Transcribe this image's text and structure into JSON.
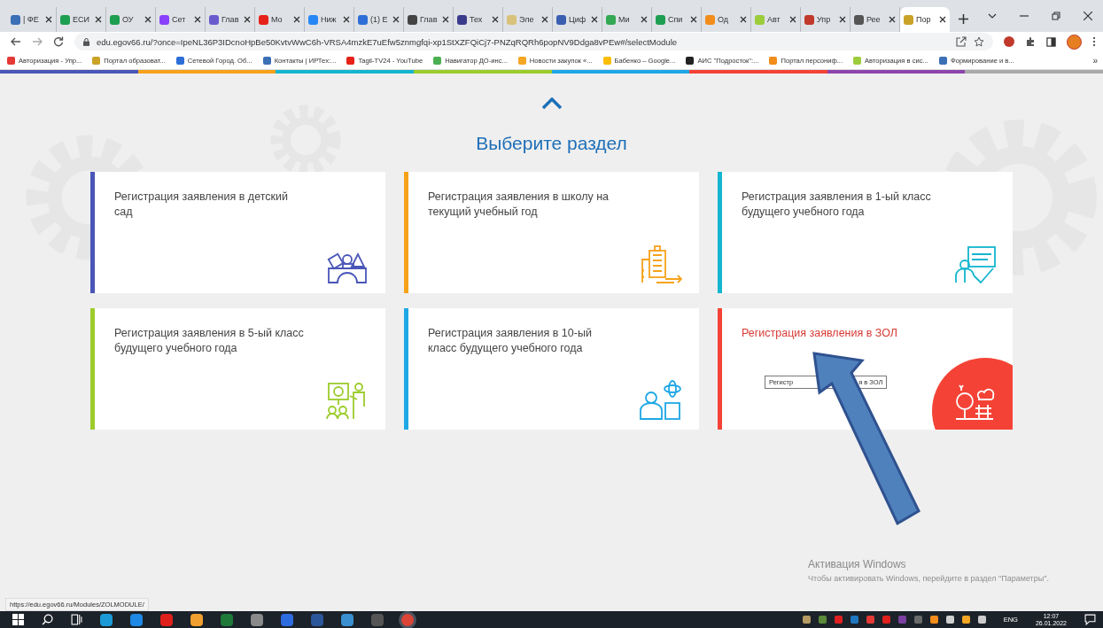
{
  "browser": {
    "tabs": [
      {
        "title": "| ФЕ",
        "selected": false,
        "color": "#3b6fb6"
      },
      {
        "title": "ЕСИ",
        "selected": false,
        "color": "#1e9e50"
      },
      {
        "title": "ОУ",
        "selected": false,
        "color": "#1e9e50"
      },
      {
        "title": "Сет",
        "selected": false,
        "color": "#8a3ffc"
      },
      {
        "title": "Глав",
        "selected": false,
        "color": "#6a5acd"
      },
      {
        "title": "Мо",
        "selected": false,
        "color": "#e62117"
      },
      {
        "title": "Ниж",
        "selected": false,
        "color": "#2787f5"
      },
      {
        "title": "(1) E",
        "selected": false,
        "color": "#2d6fd6"
      },
      {
        "title": "Глав",
        "selected": false,
        "color": "#444444"
      },
      {
        "title": "Тех",
        "selected": false,
        "color": "#3a3a8c"
      },
      {
        "title": "Эле",
        "selected": false,
        "color": "#d9c27a"
      },
      {
        "title": "Циф",
        "selected": false,
        "color": "#3a5fb0"
      },
      {
        "title": "Ми",
        "selected": false,
        "color": "#34a853"
      },
      {
        "title": "Спи",
        "selected": false,
        "color": "#1e9e50"
      },
      {
        "title": "Од",
        "selected": false,
        "color": "#f28c1b"
      },
      {
        "title": "Авт",
        "selected": false,
        "color": "#9ccc3c"
      },
      {
        "title": "Упр",
        "selected": false,
        "color": "#c0392b"
      },
      {
        "title": "Рее",
        "selected": false,
        "color": "#555555"
      },
      {
        "title": "Пор",
        "selected": true,
        "color": "#c9a227"
      }
    ],
    "url": "edu.egov66.ru/?once=IpeNL36P3IDcnoHpBe50KvtvWwC6h-VRSA4mzkE7uEfw5znmgfqi-xp1StXZFQiCj7-PNZqRQRh6popNV9Ddga8vPEw#/selectModule",
    "bookmarks": [
      {
        "title": "Авторизация - Упр...",
        "color": "#e53935"
      },
      {
        "title": "Портал образоват...",
        "color": "#c9a227"
      },
      {
        "title": "Сетевой Город. Об...",
        "color": "#2d6fd6"
      },
      {
        "title": "Контакты | ИРТех:...",
        "color": "#3b6fb6"
      },
      {
        "title": "Tagil-TV24 - YouTube",
        "color": "#e62117"
      },
      {
        "title": "Навигатор ДО-инс...",
        "color": "#4caf50"
      },
      {
        "title": "Новости закупок «...",
        "color": "#f5a623"
      },
      {
        "title": "Бабенко – Google...",
        "color": "#fbbc04"
      },
      {
        "title": "АИС \"Подросток\":...",
        "color": "#222222"
      },
      {
        "title": "Портал персониф...",
        "color": "#f28c1b"
      },
      {
        "title": "Авторизация в сис...",
        "color": "#9ccc3c"
      },
      {
        "title": "Формирование и в...",
        "color": "#3b6fb6"
      }
    ],
    "bookmarks_more": "»",
    "status_url": "https://edu.egov66.ru/Modules/ZOLMODULE/"
  },
  "page": {
    "heading": "Выберите раздел",
    "tiles": [
      {
        "title": "Регистрация заявления в детский сад",
        "color": "#4a56b8",
        "hovered": false
      },
      {
        "title": "Регистрация заявления в школу на текущий учебный год",
        "color": "#f7a21b",
        "hovered": false
      },
      {
        "title": "Регистрация заявления в 1-ый класс будущего учебного года",
        "color": "#13b5cf",
        "hovered": false
      },
      {
        "title": "Регистрация заявления в 5-ый класс будущего учебного года",
        "color": "#9ccc2c",
        "hovered": false
      },
      {
        "title": "Регистрация заявления в 10-ый класс будущего учебного года",
        "color": "#1ea7e6",
        "hovered": false
      },
      {
        "title": "Регистрация заявления в ЗОЛ",
        "color": "#f44336",
        "hovered": true
      }
    ],
    "tooltip": {
      "visible_start": "Регистр",
      "visible_end": "я в ЗОЛ"
    }
  },
  "windows_activation": {
    "title": "Активация Windows",
    "text": "Чтобы активировать Windows, перейдите в раздел \"Параметры\"."
  },
  "taskbar": {
    "language": "ENG",
    "time": "12:07",
    "date": "26.01.2022"
  }
}
